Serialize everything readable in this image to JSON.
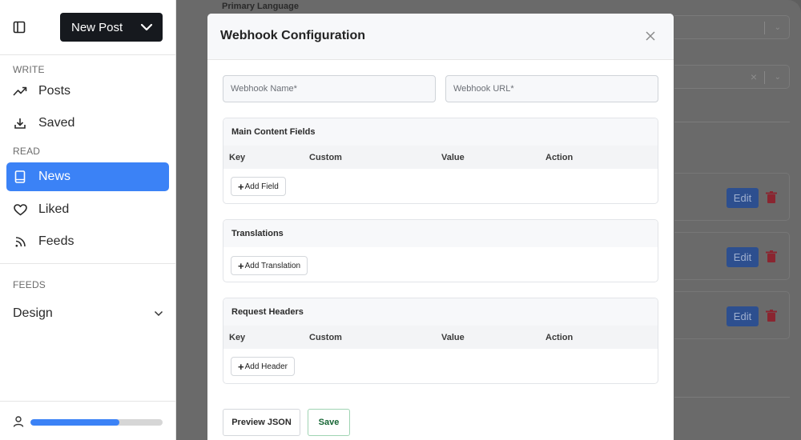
{
  "sidebar": {
    "new_post_label": "New Post",
    "sections": {
      "write": "WRITE",
      "read": "READ",
      "feeds": "FEEDS"
    },
    "items": [
      {
        "label": "Posts",
        "icon": "trending-up-icon"
      },
      {
        "label": "Saved",
        "icon": "download-icon"
      },
      {
        "label": "News",
        "icon": "book-icon",
        "active": true
      },
      {
        "label": "Liked",
        "icon": "heart-icon"
      },
      {
        "label": "Feeds",
        "icon": "rss-icon"
      }
    ],
    "design_label": "Design",
    "progress": 0.67,
    "accent_color": "#3b82f6"
  },
  "background": {
    "primary_language_label": "Primary Language",
    "edit_label": "Edit"
  },
  "modal": {
    "title": "Webhook Configuration",
    "webhook_name_placeholder": "Webhook Name*",
    "webhook_url_placeholder": "Webhook URL*",
    "main_content": {
      "title": "Main Content Fields",
      "columns": [
        "Key",
        "Custom",
        "Value",
        "Action"
      ],
      "add_label": "Add Field"
    },
    "translations": {
      "title": "Translations",
      "add_label": "Add Translation"
    },
    "request_headers": {
      "title": "Request Headers",
      "columns": [
        "Key",
        "Custom",
        "Value",
        "Action"
      ],
      "add_label": "Add Header"
    },
    "preview_label": "Preview JSON",
    "save_label": "Save"
  }
}
